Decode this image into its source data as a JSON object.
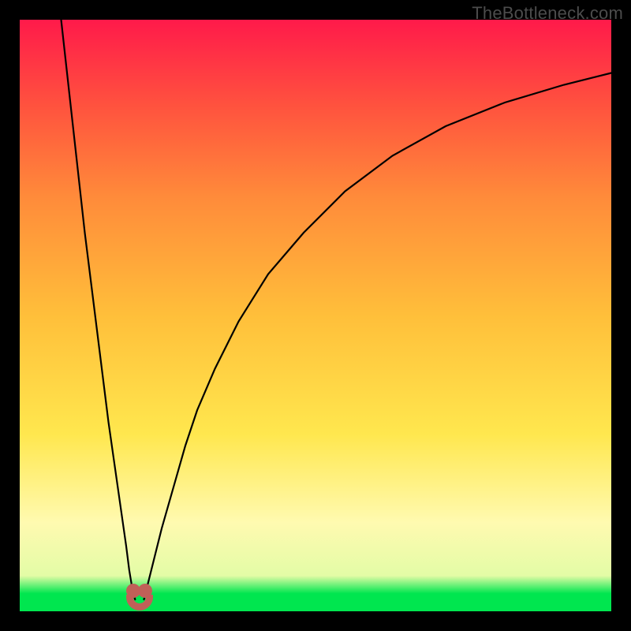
{
  "watermark": "TheBottleneck.com",
  "colors": {
    "frame": "#000000",
    "marker": "#c06058",
    "curve": "#000000"
  },
  "chart_data": {
    "type": "line",
    "title": "",
    "xlabel": "",
    "ylabel": "",
    "xlim": [
      0,
      100
    ],
    "ylim": [
      0,
      100
    ],
    "grid": false,
    "gradient_stops": [
      {
        "pos": 0,
        "color": "#00e64f"
      },
      {
        "pos": 3,
        "color": "#00e64f"
      },
      {
        "pos": 6,
        "color": "#e3fca6"
      },
      {
        "pos": 15,
        "color": "#fffab0"
      },
      {
        "pos": 30,
        "color": "#ffe74e"
      },
      {
        "pos": 50,
        "color": "#ffbf3a"
      },
      {
        "pos": 70,
        "color": "#ff8b3a"
      },
      {
        "pos": 85,
        "color": "#ff543e"
      },
      {
        "pos": 100,
        "color": "#ff1a4a"
      }
    ],
    "series": [
      {
        "name": "left-branch",
        "x": [
          7,
          8,
          9,
          10,
          11,
          12,
          13,
          14,
          15,
          16,
          17,
          18,
          18.5,
          19,
          19.5
        ],
        "values": [
          100,
          91,
          82,
          73,
          64,
          56,
          48,
          40,
          32,
          25,
          18,
          11,
          7,
          4,
          2
        ]
      },
      {
        "name": "right-branch",
        "x": [
          21,
          22,
          23,
          24,
          26,
          28,
          30,
          33,
          37,
          42,
          48,
          55,
          63,
          72,
          82,
          92,
          100
        ],
        "values": [
          2,
          6,
          10,
          14,
          21,
          28,
          34,
          41,
          49,
          57,
          64,
          71,
          77,
          82,
          86,
          89,
          91
        ]
      }
    ],
    "markers": [
      {
        "x": 19.2,
        "y": 3.5
      },
      {
        "x": 21.2,
        "y": 3.5
      }
    ],
    "marker_arc": {
      "x": 20.2,
      "y": 2.0
    }
  }
}
